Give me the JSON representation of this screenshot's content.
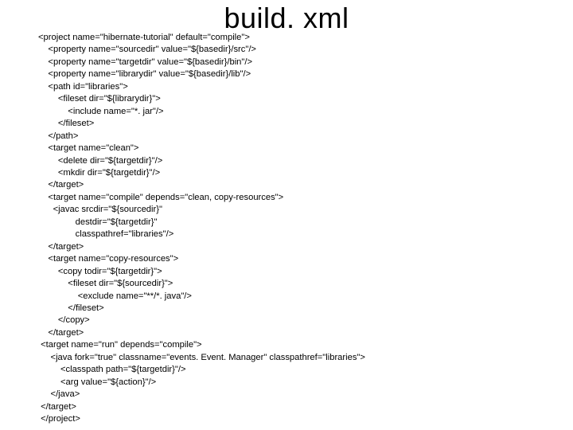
{
  "slide": {
    "title": "build. xml",
    "code_lines": [
      "<project name=\"hibernate-tutorial\" default=\"compile\">",
      "    <property name=\"sourcedir\" value=\"${basedir}/src\"/>",
      "    <property name=\"targetdir\" value=\"${basedir}/bin\"/>",
      "    <property name=\"librarydir\" value=\"${basedir}/lib\"/>",
      "    <path id=\"libraries\">",
      "        <fileset dir=\"${librarydir}\">",
      "            <include name=\"*. jar\"/>",
      "        </fileset>",
      "    </path>",
      "    <target name=\"clean\">",
      "        <delete dir=\"${targetdir}\"/>",
      "        <mkdir dir=\"${targetdir}\"/>",
      "    </target>",
      "    <target name=\"compile\" depends=\"clean, copy-resources\">",
      "      <javac srcdir=\"${sourcedir}\"",
      "               destdir=\"${targetdir}\"",
      "               classpathref=\"libraries\"/>",
      "    </target>",
      "    <target name=\"copy-resources\">",
      "        <copy todir=\"${targetdir}\">",
      "            <fileset dir=\"${sourcedir}\">",
      "                <exclude name=\"**/*. java\"/>",
      "            </fileset>",
      "        </copy>",
      "    </target>",
      " <target name=\"run\" depends=\"compile\">",
      "     <java fork=\"true\" classname=\"events. Event. Manager\" classpathref=\"libraries\">",
      "         <classpath path=\"${targetdir}\"/>",
      "         <arg value=\"${action}\"/>",
      "     </java>",
      " </target>",
      " </project>"
    ]
  }
}
